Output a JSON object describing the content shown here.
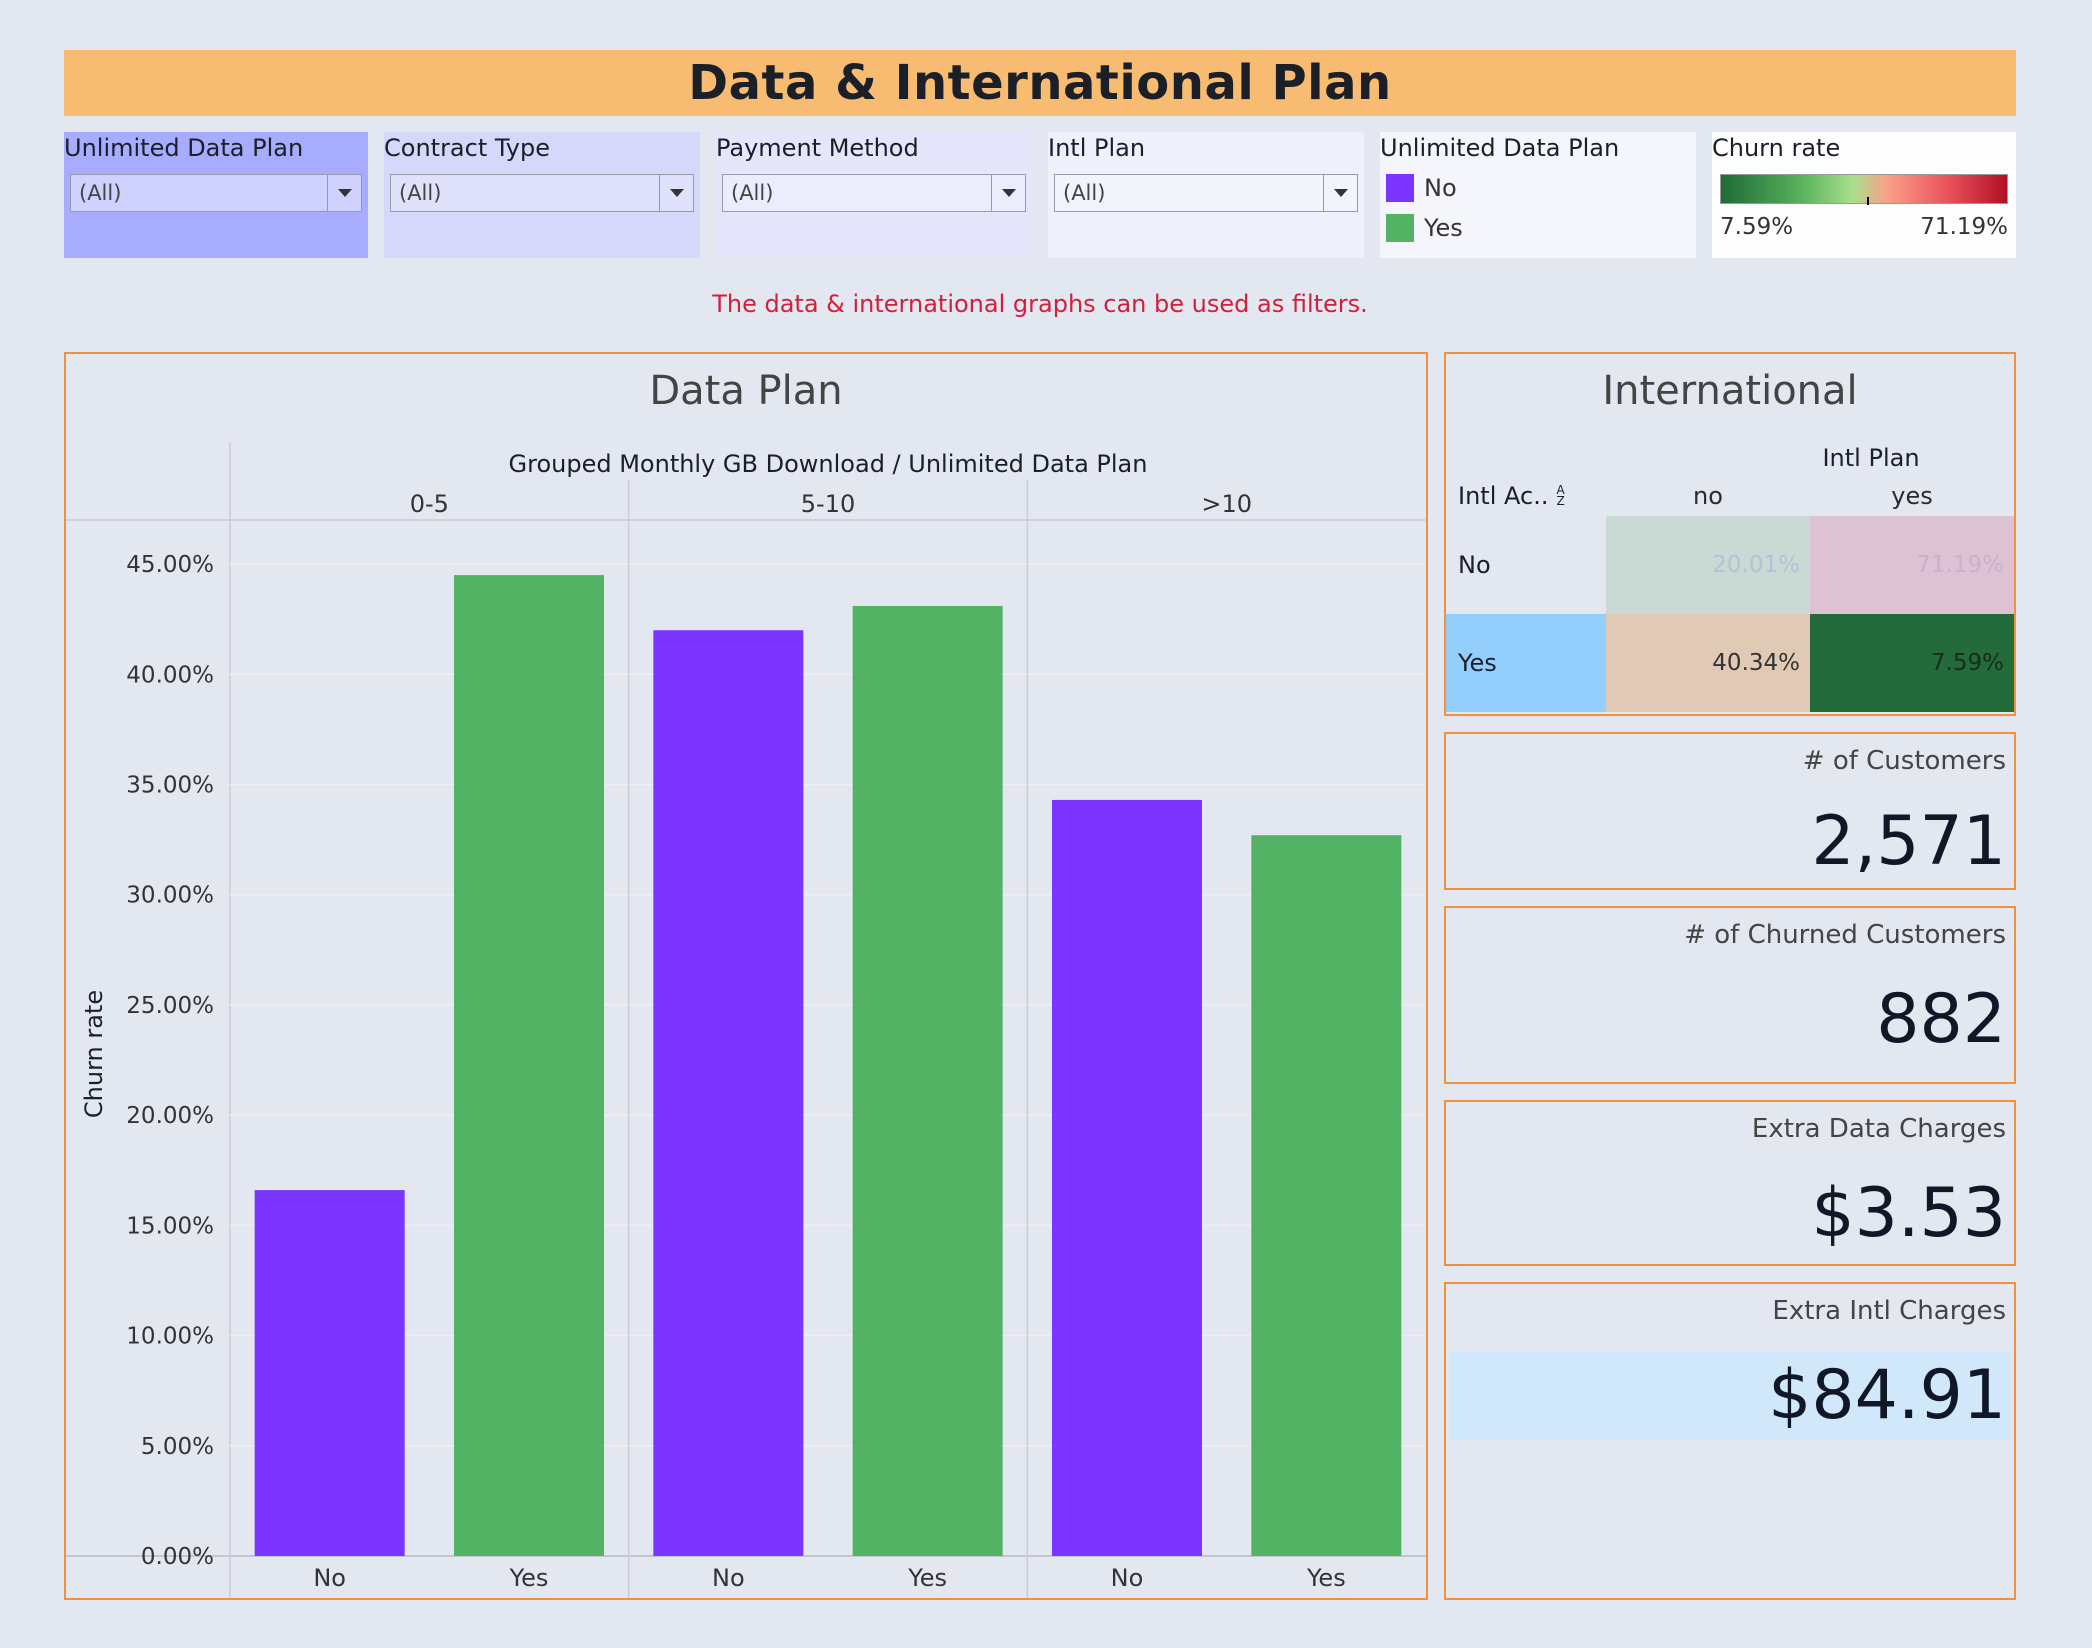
{
  "title": "Data & International Plan",
  "filters": [
    {
      "label": "Unlimited Data Plan",
      "value": "(All)"
    },
    {
      "label": "Contract Type",
      "value": "(All)"
    },
    {
      "label": "Payment Method",
      "value": "(All)"
    },
    {
      "label": "Intl Plan",
      "value": "(All)"
    }
  ],
  "data_plan_legend": {
    "title": "Unlimited Data Plan",
    "items": [
      {
        "label": "No",
        "color": "#7b35ff"
      },
      {
        "label": "Yes",
        "color": "#52b364"
      }
    ]
  },
  "churn_legend": {
    "title": "Churn rate",
    "min": "7.59%",
    "max": "71.19%"
  },
  "note": "The data & international graphs can be used as filters.",
  "data_plan": {
    "title": "Data Plan",
    "header": "Grouped Monthly GB Download  /  Unlimited Data Plan",
    "y_axis_label": "Churn rate"
  },
  "international": {
    "title": "International",
    "column_header": "Intl Plan",
    "row_header": "Intl Ac..",
    "sort_icon": "sort-az-icon",
    "columns": [
      "no",
      "yes"
    ],
    "rows": [
      {
        "label": "No",
        "cells": [
          "20.01%",
          "71.19%"
        ]
      },
      {
        "label": "Yes",
        "cells": [
          "40.34%",
          "7.59%"
        ]
      }
    ]
  },
  "kpis": [
    {
      "label": "# of Customers",
      "value": "2,571"
    },
    {
      "label": "# of Churned Customers",
      "value": "882"
    },
    {
      "label": "Extra Data Charges",
      "value": "$3.53"
    },
    {
      "label": "Extra Intl Charges",
      "value": "$84.91"
    }
  ],
  "chart_data": {
    "type": "bar",
    "groups": [
      "0-5",
      "5-10",
      ">10"
    ],
    "categories": [
      "No",
      "Yes"
    ],
    "series": [
      {
        "name": "No",
        "color": "#7b35ff",
        "values": [
          16.6,
          42.0,
          34.3
        ]
      },
      {
        "name": "Yes",
        "color": "#52b364",
        "values": [
          44.5,
          43.1,
          32.7
        ]
      }
    ],
    "ylabel": "Churn rate",
    "ylim": [
      0,
      47
    ],
    "yticks": [
      "0.00%",
      "5.00%",
      "10.00%",
      "15.00%",
      "20.00%",
      "25.00%",
      "30.00%",
      "35.00%",
      "40.00%",
      "45.00%"
    ],
    "ytick_values": [
      0,
      5,
      10,
      15,
      20,
      25,
      30,
      35,
      40,
      45
    ],
    "grid": true
  }
}
